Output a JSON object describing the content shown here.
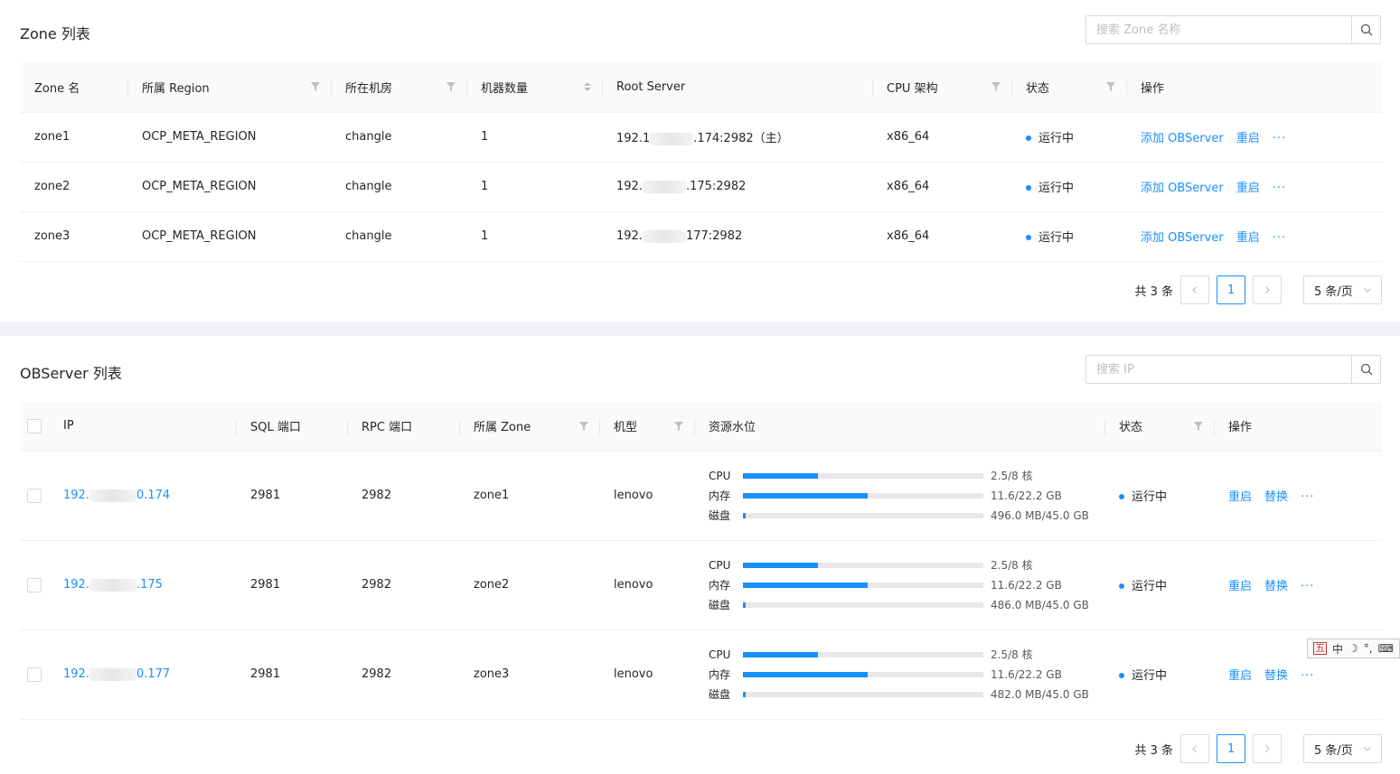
{
  "zone_card": {
    "title": "Zone 列表",
    "search_placeholder": "搜索 Zone 名称",
    "columns": [
      "Zone 名",
      "所属 Region",
      "所在机房",
      "机器数量",
      "Root Server",
      "CPU 架构",
      "状态",
      "操作"
    ],
    "rows": [
      {
        "name": "zone1",
        "region": "OCP_META_REGION",
        "idc": "changle",
        "count": "1",
        "rs_prefix": "192.1",
        "rs_suffix": ".174:2982（主）",
        "arch": "x86_64",
        "status": "运行中",
        "add": "添加 OBServer",
        "restart": "重启",
        "more": "···"
      },
      {
        "name": "zone2",
        "region": "OCP_META_REGION",
        "idc": "changle",
        "count": "1",
        "rs_prefix": "192.",
        "rs_suffix": ".175:2982",
        "arch": "x86_64",
        "status": "运行中",
        "add": "添加 OBServer",
        "restart": "重启",
        "more": "···"
      },
      {
        "name": "zone3",
        "region": "OCP_META_REGION",
        "idc": "changle",
        "count": "1",
        "rs_prefix": "192.",
        "rs_suffix": "177:2982",
        "arch": "x86_64",
        "status": "运行中",
        "add": "添加 OBServer",
        "restart": "重启",
        "more": "···"
      }
    ],
    "pagination": {
      "total": "共 3 条",
      "page": "1",
      "size": "5 条/页"
    }
  },
  "observer_card": {
    "title": "OBServer 列表",
    "search_placeholder": "搜索 IP",
    "columns": [
      "IP",
      "SQL 端口",
      "RPC 端口",
      "所属 Zone",
      "机型",
      "资源水位",
      "状态",
      "操作"
    ],
    "resource_labels": {
      "cpu": "CPU",
      "mem": "内存",
      "disk": "磁盘"
    },
    "rows": [
      {
        "ip_prefix": "192.",
        "ip_suffix": "0.174",
        "sql": "2981",
        "rpc": "2982",
        "zone": "zone1",
        "model": "lenovo",
        "cpu": {
          "fraction": 0.3125,
          "text": "2.5/8 核"
        },
        "mem": {
          "fraction": 0.52,
          "text": "11.6/22.2 GB"
        },
        "disk": {
          "fraction": 0.011,
          "text": "496.0 MB/45.0 GB"
        },
        "status": "运行中",
        "restart": "重启",
        "replace": "替换",
        "more": "···"
      },
      {
        "ip_prefix": "192.",
        "ip_suffix": ".175",
        "sql": "2981",
        "rpc": "2982",
        "zone": "zone2",
        "model": "lenovo",
        "cpu": {
          "fraction": 0.3125,
          "text": "2.5/8 核"
        },
        "mem": {
          "fraction": 0.52,
          "text": "11.6/22.2 GB"
        },
        "disk": {
          "fraction": 0.011,
          "text": "486.0 MB/45.0 GB"
        },
        "status": "运行中",
        "restart": "重启",
        "replace": "替换",
        "more": "···"
      },
      {
        "ip_prefix": "192.",
        "ip_suffix": "0.177",
        "sql": "2981",
        "rpc": "2982",
        "zone": "zone3",
        "model": "lenovo",
        "cpu": {
          "fraction": 0.3125,
          "text": "2.5/8 核"
        },
        "mem": {
          "fraction": 0.52,
          "text": "11.6/22.2 GB"
        },
        "disk": {
          "fraction": 0.011,
          "text": "482.0 MB/45.0 GB"
        },
        "status": "运行中",
        "restart": "重启",
        "replace": "替换",
        "more": "···"
      }
    ],
    "pagination": {
      "total": "共 3 条",
      "page": "1",
      "size": "5 条/页"
    }
  },
  "ime_bar": {
    "wu": "五",
    "zhong": "中",
    "moon": "☽",
    "punct": "°,",
    "keyboard": "⌨"
  },
  "colors": {
    "accent": "#1890ff",
    "border": "#d9d9d9",
    "header_bg": "#fafafa",
    "gap_bg": "#f0f2f5"
  }
}
